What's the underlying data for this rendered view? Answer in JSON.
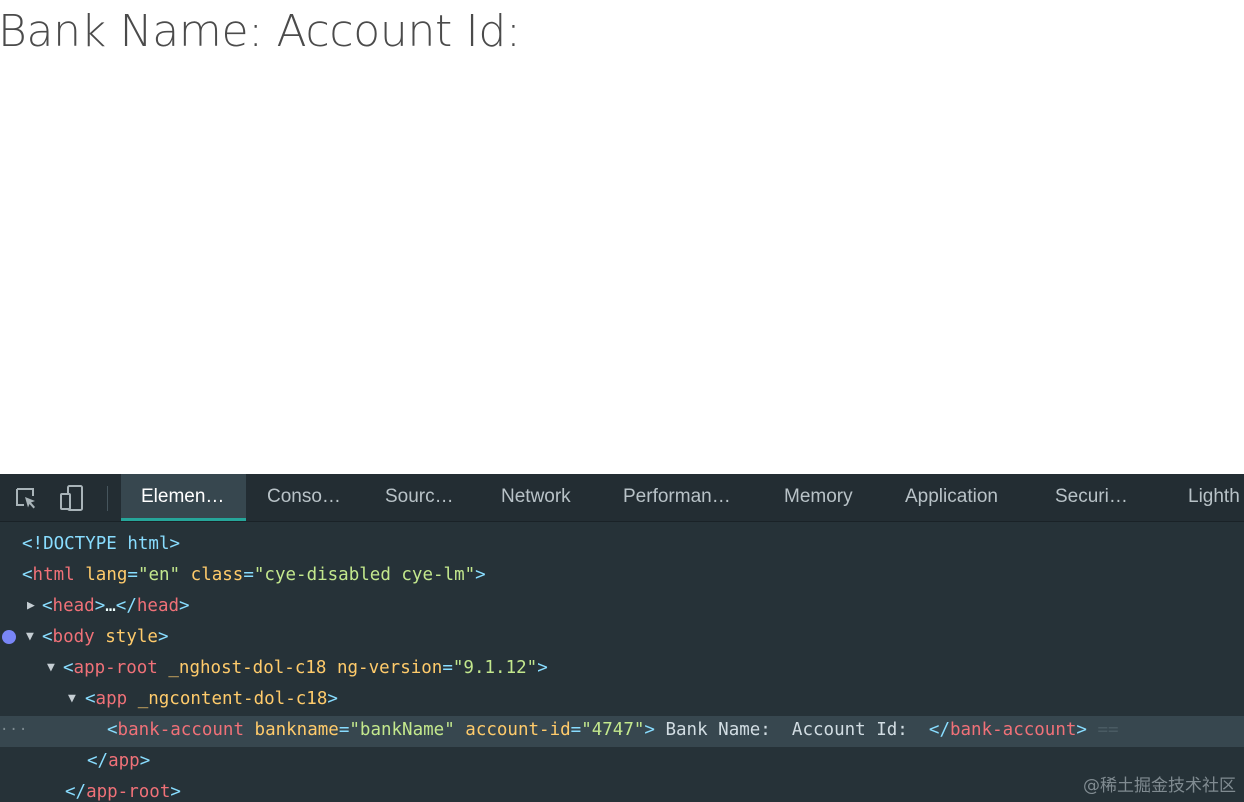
{
  "page": {
    "heading": "Bank Name: Account Id:"
  },
  "devtools": {
    "toolbar": {
      "inspect_icon": "select-element-icon",
      "device_icon": "device-toolbar-icon",
      "tabs": [
        {
          "label": "Elemen…",
          "active": true
        },
        {
          "label": "Conso…",
          "active": false
        },
        {
          "label": "Sourc…",
          "active": false
        },
        {
          "label": "Network",
          "active": false
        },
        {
          "label": "Performan…",
          "active": false
        },
        {
          "label": "Memory",
          "active": false
        },
        {
          "label": "Application",
          "active": false
        },
        {
          "label": "Securi…",
          "active": false
        },
        {
          "label": "Lighth",
          "active": false
        }
      ]
    },
    "dom": {
      "doctype": "<!DOCTYPE html>",
      "html": {
        "tag": "html",
        "attr1_name": "lang",
        "attr1_value": "\"en\"",
        "attr2_name": "class",
        "attr2_value": "\"cye-disabled cye-lm\""
      },
      "head": {
        "tag": "head",
        "ellipsis": "…"
      },
      "body": {
        "tag": "body",
        "attr_name": "style"
      },
      "app_root": {
        "tag": "app-root",
        "attr1_name": "_nghost-dol-c18",
        "attr2_name": "ng-version",
        "attr2_value": "\"9.1.12\""
      },
      "app": {
        "tag": "app",
        "attr_name": "_ngcontent-dol-c18"
      },
      "bank_account": {
        "tag": "bank-account",
        "attr1_name": "bankname",
        "attr1_value": "\"bankName\"",
        "attr2_name": "account-id",
        "attr2_value": "\"4747\"",
        "text": " Bank Name:  Account Id: ",
        "trailing": "=="
      },
      "close_app": "app",
      "close_app_root": "app-root",
      "row_dots": "···"
    },
    "colors": {
      "panel_bg": "#263238",
      "selected_row_bg": "#37474f",
      "active_tab_indicator": "#26a69a",
      "breakpoint_dot": "#7986f7",
      "tag_color": "#f07178",
      "attr_color": "#ffcb6b",
      "value_color": "#c3e88d",
      "bracket_color": "#89ddff"
    }
  },
  "watermark": "@稀土掘金技术社区"
}
